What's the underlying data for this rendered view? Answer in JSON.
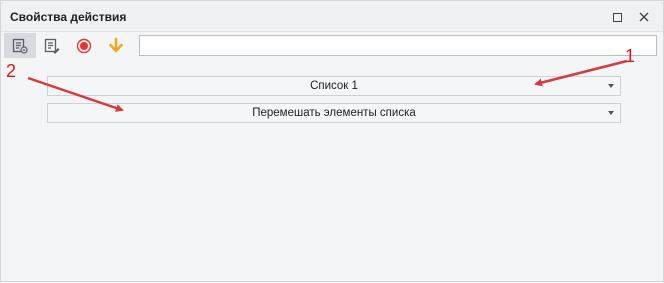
{
  "window": {
    "title": "Свойства действия"
  },
  "toolbar": {
    "search_value": "",
    "icons": [
      "action-properties-icon",
      "edit-action-icon",
      "record-icon",
      "download-arrow-icon"
    ]
  },
  "dropdowns": [
    {
      "value": "Список 1"
    },
    {
      "value": "Перемешать элементы списка"
    }
  ],
  "annotations": {
    "marker_1": "1",
    "marker_2": "2",
    "color": "#e0141a"
  },
  "colors": {
    "record": "#e8323a",
    "download_arrow": "#f2a826"
  }
}
